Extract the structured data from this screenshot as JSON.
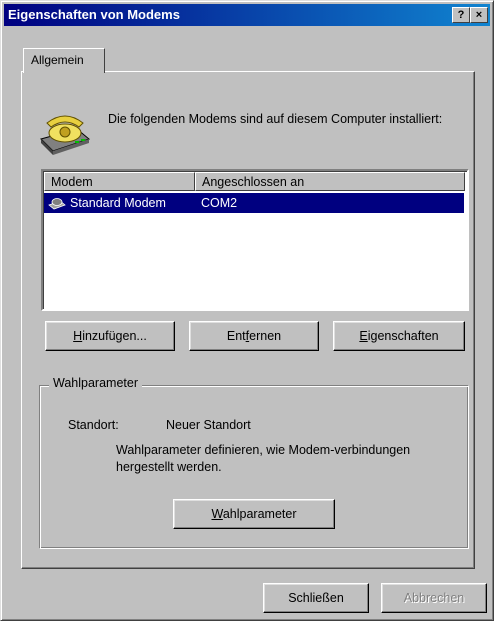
{
  "window": {
    "title": "Eigenschaften von Modems",
    "help_button": "?",
    "close_button": "×"
  },
  "tab": {
    "label": "Allgemein"
  },
  "intro_text": "Die folgenden Modems sind auf diesem Computer installiert:",
  "modem_list": {
    "columns": [
      "Modem",
      "Angeschlossen an"
    ],
    "rows": [
      {
        "modem": "Standard Modem",
        "port": "COM2",
        "selected": true
      }
    ]
  },
  "buttons": {
    "add": {
      "prefix": "",
      "mnemonic": "H",
      "rest": "inzufügen..."
    },
    "remove": {
      "prefix": "Ent",
      "mnemonic": "f",
      "rest": "ernen"
    },
    "properties": {
      "prefix": "",
      "mnemonic": "E",
      "rest": "igenschaften"
    },
    "dial_params": {
      "prefix": "",
      "mnemonic": "W",
      "rest": "ahlparameter"
    },
    "close": "Schließen",
    "cancel": "Abbrechen"
  },
  "dialing_group": {
    "title": "Wahlparameter",
    "location_label": "Standort:",
    "location_value": "Neuer Standort",
    "description": "Wahlparameter definieren, wie Modem-verbindungen hergestellt werden."
  },
  "icons": {
    "modem": "telephone-modem-icon",
    "row": "modem-row-icon"
  },
  "colors": {
    "titlebar_start": "#000080",
    "titlebar_end": "#1084d0",
    "selection": "#000080",
    "face": "#c0c0c0"
  }
}
